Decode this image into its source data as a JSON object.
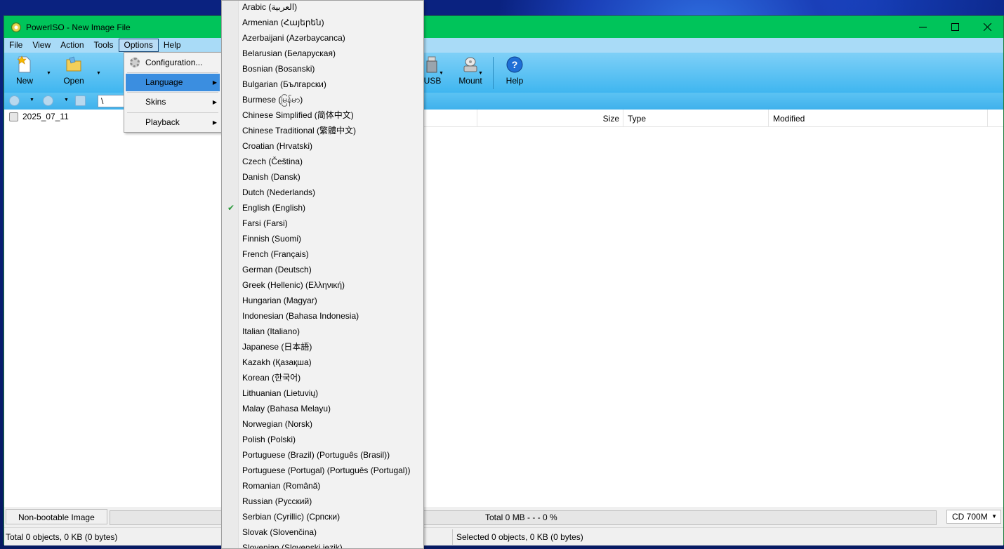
{
  "window": {
    "title": "PowerISO - New Image File",
    "controls": [
      "minimize",
      "maximize",
      "close"
    ]
  },
  "menubar": [
    "File",
    "View",
    "Action",
    "Tools",
    "Options",
    "Help"
  ],
  "toolbar": {
    "new_label": "New",
    "open_label": "Open",
    "usb_label": "USB",
    "mount_label": "Mount",
    "help_label": "Help"
  },
  "address": {
    "path": "\\"
  },
  "tree": {
    "root": "2025_07_11"
  },
  "list_columns": [
    "Size",
    "Type",
    "Modified"
  ],
  "status": {
    "boot": "Non-bootable Image",
    "total": "Total  0 MB   - - -  0 %",
    "media": "CD 700M",
    "left": "Total 0 objects, 0 KB (0 bytes)",
    "right": "Selected 0 objects, 0 KB (0 bytes)"
  },
  "options_menu": {
    "items": [
      "Configuration...",
      "Language",
      "Skins",
      "Playback"
    ],
    "highlighted": "Language"
  },
  "language_menu": {
    "selected": "English (English)",
    "items": [
      "Arabic (العربية)",
      "Armenian (Հայերեն)",
      "Azerbaijani (Azərbaycanca)",
      "Belarusian (Беларуская)",
      "Bosnian (Bosanski)",
      "Bulgarian (Български)",
      "Burmese (မြန်မာ)",
      "Chinese Simplified (简体中文)",
      "Chinese Traditional (繁體中文)",
      "Croatian (Hrvatski)",
      "Czech (Čeština)",
      "Danish (Dansk)",
      "Dutch (Nederlands)",
      "English (English)",
      "Farsi (Farsi)",
      "Finnish (Suomi)",
      "French (Français)",
      "German (Deutsch)",
      "Greek (Hellenic) (Ελληνική)",
      "Hungarian (Magyar)",
      "Indonesian (Bahasa Indonesia)",
      "Italian (Italiano)",
      "Japanese (日本語)",
      "Kazakh (Қазақша)",
      "Korean (한국어)",
      "Lithuanian (Lietuvių)",
      "Malay (Bahasa Melayu)",
      "Norwegian (Norsk)",
      "Polish (Polski)",
      "Portuguese (Brazil) (Português (Brasil))",
      "Portuguese (Portugal) (Português (Portugal))",
      "Romanian (Română)",
      "Russian (Русский)",
      "Serbian (Cyrillic) (Српски)",
      "Slovak (Slovenčina)",
      "Slovenian (Slovenski jezik)"
    ]
  }
}
